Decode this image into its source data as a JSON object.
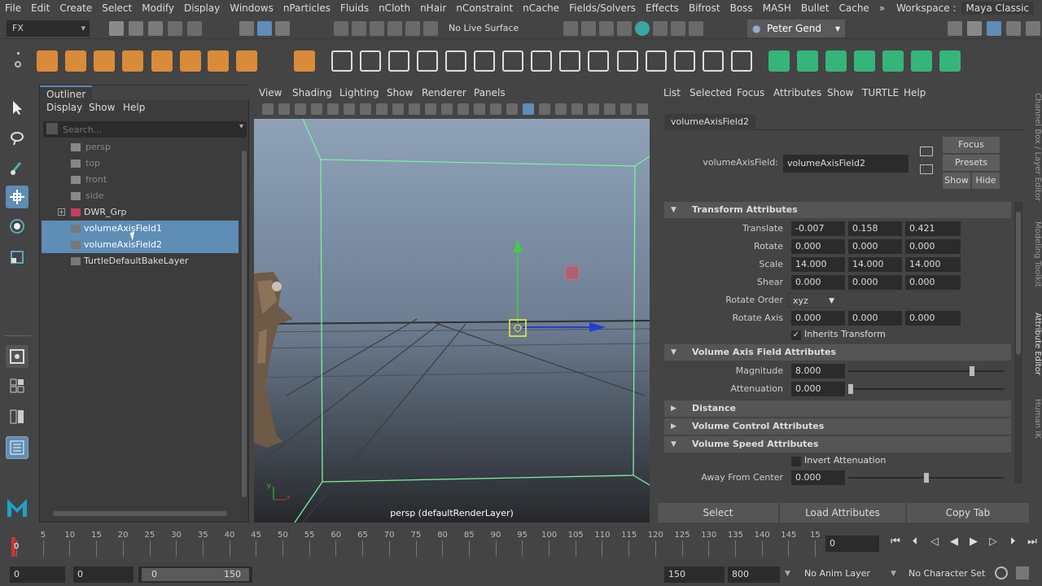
{
  "menubar": {
    "items": [
      "File",
      "Edit",
      "Create",
      "Select",
      "Modify",
      "Display",
      "Windows",
      "nParticles",
      "Fluids",
      "nCloth",
      "nHair",
      "nConstraint",
      "nCache",
      "Fields/Solvers",
      "Effects",
      "Bifrost",
      "Boss",
      "MASH",
      "Bullet",
      "Cache"
    ],
    "more": "»",
    "workspace_label": "Workspace :",
    "workspace_value": "Maya Classic"
  },
  "statusline": {
    "menuset": "FX",
    "live_surface": "No Live Surface",
    "user": "Peter Gend"
  },
  "outliner": {
    "tab": "Outliner",
    "menu": [
      "Display",
      "Show",
      "Help"
    ],
    "search_placeholder": "Search...",
    "items": [
      {
        "label": "persp",
        "type": "camera",
        "dim": true
      },
      {
        "label": "top",
        "type": "camera",
        "dim": true
      },
      {
        "label": "front",
        "type": "camera",
        "dim": true
      },
      {
        "label": "side",
        "type": "camera",
        "dim": true
      },
      {
        "label": "DWR_Grp",
        "type": "group",
        "expand": "+"
      },
      {
        "label": "volumeAxisField1",
        "type": "field",
        "selected": true
      },
      {
        "label": "volumeAxisField2",
        "type": "field",
        "selected": true
      },
      {
        "label": "TurtleDefaultBakeLayer",
        "type": "layer"
      }
    ]
  },
  "viewport": {
    "menu": [
      "View",
      "Shading",
      "Lighting",
      "Show",
      "Renderer",
      "Panels"
    ],
    "camera_label": "persp (defaultRenderLayer)",
    "axis_y": "y",
    "axis_x": "x"
  },
  "attribute_editor": {
    "menu": [
      "List",
      "Selected",
      "Focus",
      "Attributes",
      "Show",
      "TURTLE",
      "Help"
    ],
    "tab": "volumeAxisField2",
    "node_type_label": "volumeAxisField:",
    "node_name": "volumeAxisField2",
    "focus_btn": "Focus",
    "presets_btn": "Presets",
    "show_btn": "Show",
    "hide_btn": "Hide",
    "sections": {
      "transform": "Transform Attributes",
      "vaf": "Volume Axis Field Attributes",
      "distance": "Distance",
      "control": "Volume Control Attributes",
      "speed": "Volume Speed Attributes"
    },
    "translate": {
      "label": "Translate",
      "values": [
        "-0.007",
        "0.158",
        "0.421"
      ]
    },
    "rotate": {
      "label": "Rotate",
      "values": [
        "0.000",
        "0.000",
        "0.000"
      ]
    },
    "scale": {
      "label": "Scale",
      "values": [
        "14.000",
        "14.000",
        "14.000"
      ]
    },
    "shear": {
      "label": "Shear",
      "values": [
        "0.000",
        "0.000",
        "0.000"
      ]
    },
    "rotate_order": {
      "label": "Rotate Order",
      "value": "xyz"
    },
    "rotate_axis": {
      "label": "Rotate Axis",
      "values": [
        "0.000",
        "0.000",
        "0.000"
      ]
    },
    "inherits_transform": "Inherits Transform",
    "magnitude": {
      "label": "Magnitude",
      "value": "8.000",
      "slider": 0.8
    },
    "attenuation": {
      "label": "Attenuation",
      "value": "0.000",
      "slider": 0.0
    },
    "invert_attenuation": "Invert Attenuation",
    "away_from_center": {
      "label": "Away From Center",
      "value": "0.000",
      "slider": 0.5
    },
    "bottom_buttons": [
      "Select",
      "Load Attributes",
      "Copy Tab"
    ]
  },
  "side_tabs": [
    "Channel Box / Layer Editor",
    "Modeling Toolkit",
    "Attribute Editor",
    "Human IK"
  ],
  "timeline": {
    "ticks": [
      "5",
      "10",
      "15",
      "20",
      "25",
      "30",
      "35",
      "40",
      "45",
      "50",
      "55",
      "60",
      "65",
      "70",
      "75",
      "80",
      "85",
      "90",
      "95",
      "100",
      "105",
      "110",
      "115",
      "120",
      "125",
      "130",
      "135",
      "140",
      "145",
      "15"
    ],
    "current_frame": "0",
    "current_field": "0"
  },
  "range": {
    "start": "0",
    "anim_start": "0",
    "slider_start": "0",
    "slider_end": "150",
    "end": "150",
    "anim_end": "800",
    "anim_layer": "No Anim Layer",
    "character_set": "No Character Set"
  }
}
